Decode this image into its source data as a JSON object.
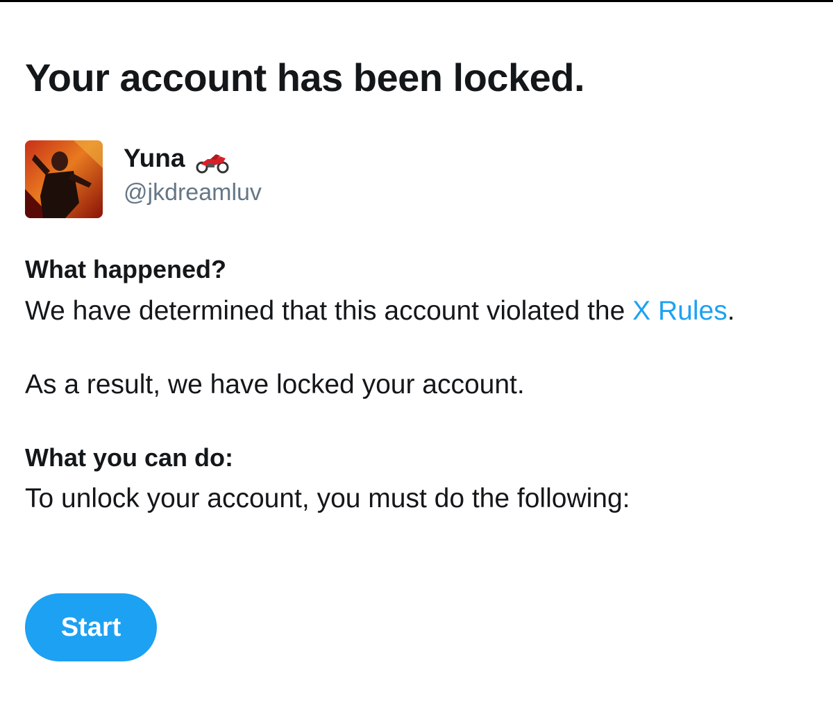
{
  "page": {
    "title": "Your account has been locked."
  },
  "profile": {
    "display_name": "Yuna",
    "name_emoji": "motorcycle-icon",
    "handle": "@jkdreamluv"
  },
  "what_happened": {
    "heading": "What happened?",
    "text_before_link": "We have determined that this account violated the ",
    "link_text": "X Rules",
    "text_after_link": ".",
    "result_text": "As a result, we have locked your account."
  },
  "what_you_can_do": {
    "heading": "What you can do:",
    "text": "To unlock your account, you must do the following:"
  },
  "actions": {
    "start_label": "Start"
  },
  "colors": {
    "accent": "#1da1f2",
    "text_primary": "#14171a",
    "text_secondary": "#657786"
  }
}
